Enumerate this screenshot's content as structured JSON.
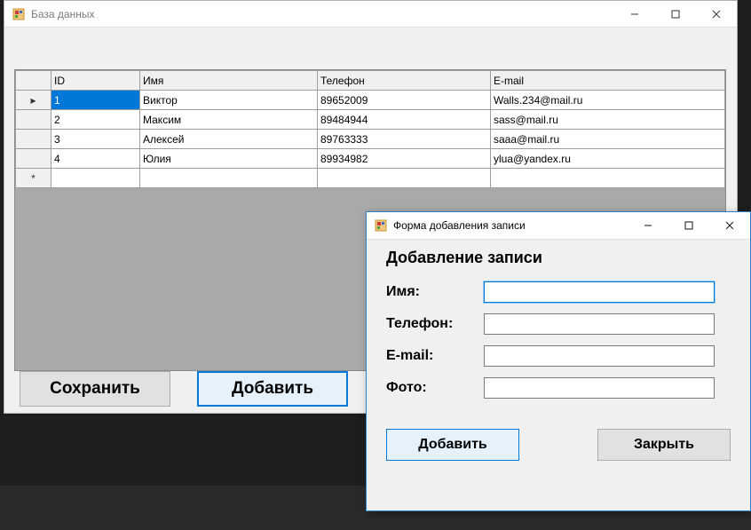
{
  "main": {
    "title": "База данных",
    "buttons": {
      "save": "Сохранить",
      "add": "Добавить"
    }
  },
  "grid": {
    "headers": {
      "id": "ID",
      "name": "Имя",
      "tel": "Телефон",
      "mail": "E-mail"
    },
    "selected_row": 0,
    "rows": [
      {
        "id": "1",
        "name": "Виктор",
        "tel": "89652009",
        "mail": "Walls.234@mail.ru"
      },
      {
        "id": "2",
        "name": "Максим",
        "tel": "89484944",
        "mail": "sass@mail.ru"
      },
      {
        "id": "3",
        "name": "Алексей",
        "tel": "89763333",
        "mail": "saaa@mail.ru"
      },
      {
        "id": "4",
        "name": "Юлия",
        "tel": "89934982",
        "mail": "ylua@yandex.ru"
      }
    ]
  },
  "dialog": {
    "title": "Форма добавления записи",
    "heading": "Добавление записи",
    "labels": {
      "name": "Имя:",
      "tel": "Телефон:",
      "mail": "E-mail:",
      "photo": "Фото:"
    },
    "values": {
      "name": "",
      "tel": "",
      "mail": "",
      "photo": ""
    },
    "buttons": {
      "add": "Добавить",
      "close": "Закрыть"
    }
  },
  "icons": {
    "app": "winforms-app-icon",
    "minimize": "minimize-icon",
    "maximize": "maximize-icon",
    "close": "close-icon",
    "rowptr": "row-pointer-icon",
    "newrow": "new-row-icon"
  }
}
